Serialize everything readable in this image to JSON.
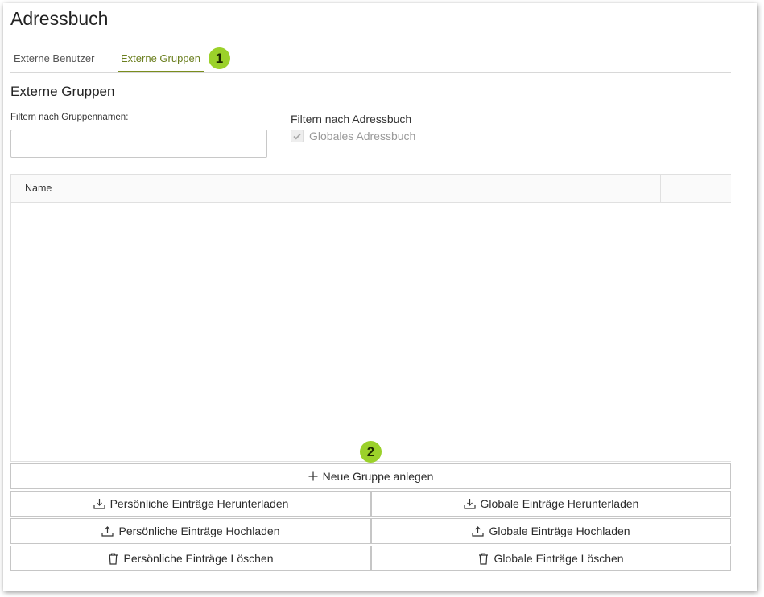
{
  "app": {
    "title": "Adressbuch"
  },
  "tabs": [
    {
      "label": "Externe Benutzer"
    },
    {
      "label": "Externe Gruppen"
    }
  ],
  "section": {
    "title": "Externe Gruppen"
  },
  "filter": {
    "name_label": "Filtern nach Gruppennamen:",
    "name_value": "",
    "addressbook_label": "Filtern nach Adressbuch",
    "global_checkbox_label": "Globales Adressbuch",
    "global_checked": true
  },
  "table": {
    "columns": [
      "Name",
      ""
    ],
    "rows": []
  },
  "actions": {
    "new_group": "Neue Gruppe anlegen",
    "personal_download": "Persönliche Einträge Herunterladen",
    "global_download": "Globale Einträge Herunterladen",
    "personal_upload": "Persönliche Einträge Hochladen",
    "global_upload": "Globale Einträge Hochladen",
    "personal_delete": "Persönliche Einträge Löschen",
    "global_delete": "Globale Einträge Löschen"
  },
  "annotations": {
    "badge1": "1",
    "badge2": "2"
  },
  "colors": {
    "accent": "#7a8d1d",
    "badge": "#9bd12a"
  },
  "icons": {
    "new_group": "plus-icon",
    "download": "download-icon",
    "upload": "upload-icon",
    "delete": "trash-icon",
    "checkbox": "checkmark-icon"
  }
}
